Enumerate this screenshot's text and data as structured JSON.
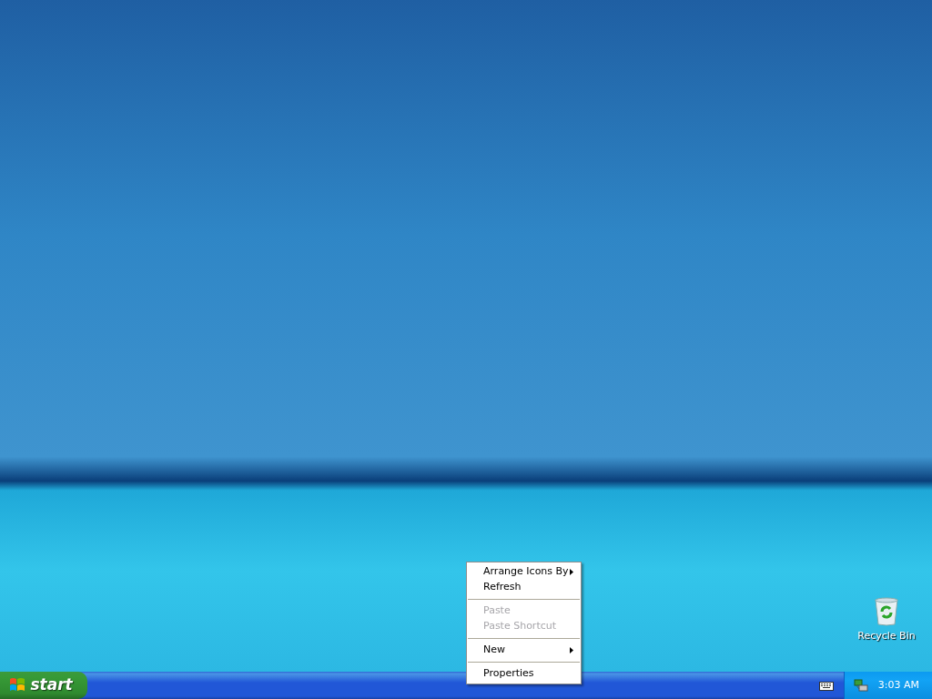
{
  "desktop": {
    "icons": [
      {
        "label": "Recycle Bin"
      }
    ]
  },
  "context_menu": {
    "items": [
      {
        "kind": "item",
        "label": "Arrange Icons By",
        "submenu": true,
        "disabled": false
      },
      {
        "kind": "item",
        "label": "Refresh",
        "submenu": false,
        "disabled": false
      },
      {
        "kind": "separator"
      },
      {
        "kind": "item",
        "label": "Paste",
        "submenu": false,
        "disabled": true
      },
      {
        "kind": "item",
        "label": "Paste Shortcut",
        "submenu": false,
        "disabled": true
      },
      {
        "kind": "separator"
      },
      {
        "kind": "item",
        "label": "New",
        "submenu": true,
        "disabled": false
      },
      {
        "kind": "separator"
      },
      {
        "kind": "item",
        "label": "Properties",
        "submenu": false,
        "disabled": false
      }
    ]
  },
  "taskbar": {
    "start_button": {
      "label": "start"
    },
    "tray": {
      "clock": "3:03 AM"
    }
  }
}
